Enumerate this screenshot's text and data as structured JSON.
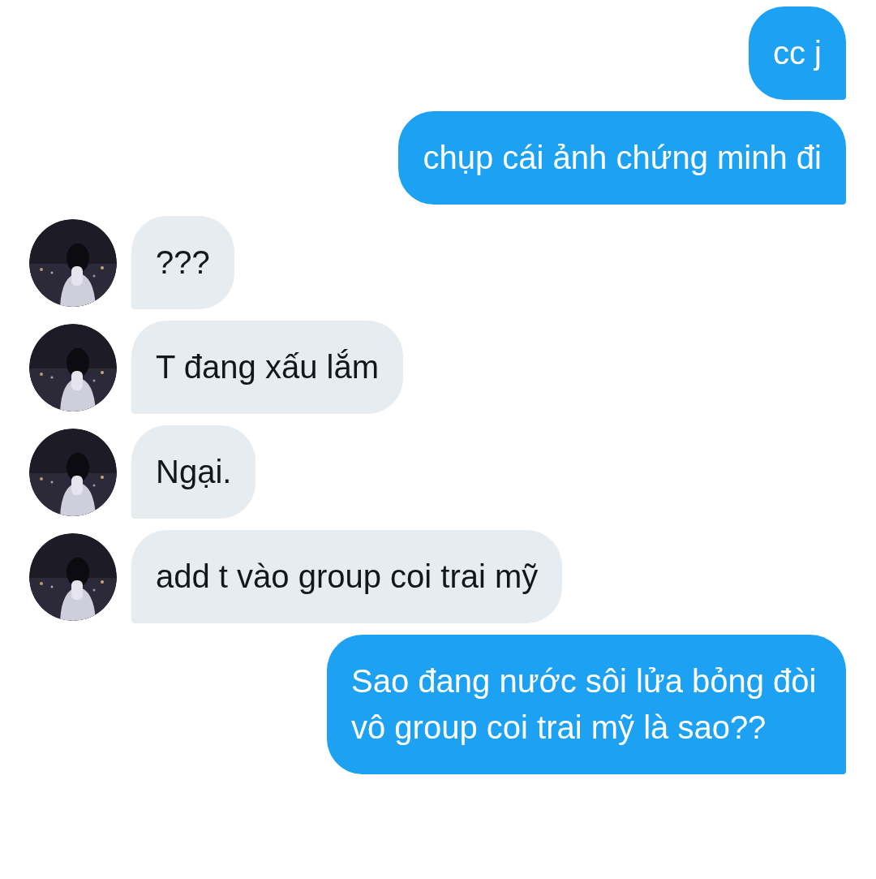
{
  "messages": [
    {
      "kind": "sent",
      "text": "cc j"
    },
    {
      "kind": "sent",
      "text": "chụp cái ảnh chứng minh đi"
    },
    {
      "kind": "received",
      "text": "???"
    },
    {
      "kind": "received",
      "text": "T đang xấu lắm"
    },
    {
      "kind": "received",
      "text": "Ngại."
    },
    {
      "kind": "received",
      "text": "add t vào group coi trai mỹ"
    },
    {
      "kind": "sent",
      "text": "Sao đang nước sôi lửa bỏng đòi vô group coi trai mỹ là sao??"
    }
  ]
}
